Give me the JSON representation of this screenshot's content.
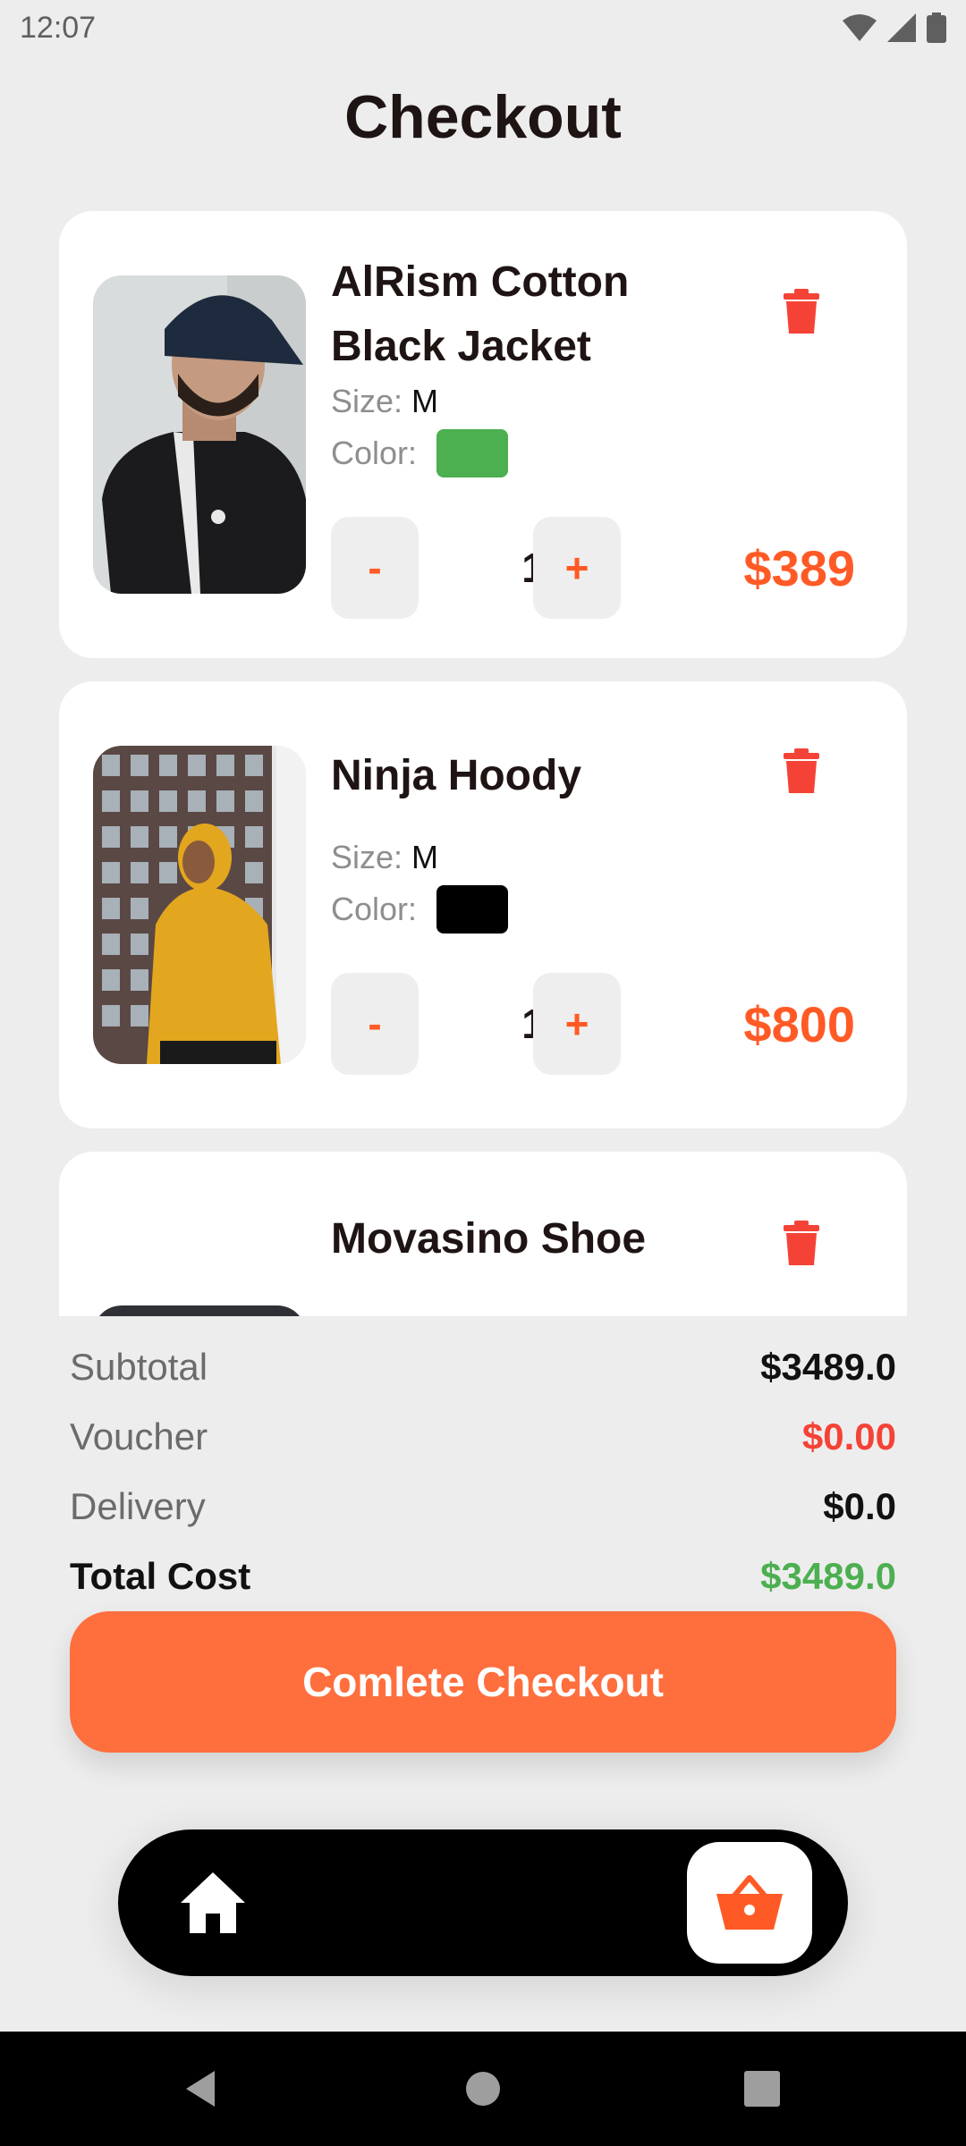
{
  "status_bar": {
    "time": "12:07"
  },
  "page": {
    "title": "Checkout"
  },
  "cart": {
    "items": [
      {
        "name": "AlRism Cotton Black Jacket",
        "size_label": "Size:",
        "size": "M",
        "color_label": "Color:",
        "color_hex": "#4caf50",
        "quantity": "1",
        "decrement_label": "-",
        "increment_label": "+",
        "price": "$389",
        "image_icon": "man-in-black-jacket-photo"
      },
      {
        "name": "Ninja Hoody",
        "size_label": "Size:",
        "size": "M",
        "color_label": "Color:",
        "color_hex": "#000000",
        "quantity": "1",
        "decrement_label": "-",
        "increment_label": "+",
        "price": "$800",
        "image_icon": "man-in-yellow-hoodie-photo"
      },
      {
        "name": "Movasino Shoe",
        "image_icon": "shoe-photo"
      }
    ]
  },
  "summary": {
    "subtotal_label": "Subtotal",
    "subtotal_value": "$3489.0",
    "voucher_label": "Voucher",
    "voucher_value": "$0.00",
    "delivery_label": "Delivery",
    "delivery_value": "$0.0",
    "total_label": "Total Cost",
    "total_value": "$3489.0"
  },
  "checkout_button": {
    "label": "Comlete Checkout"
  },
  "colors": {
    "accent": "#ff6e3d",
    "price": "#ff5a26",
    "delete": "#f44336",
    "voucher": "#f44336",
    "total": "#4caf50"
  },
  "bottom_nav": {
    "home_icon": "home-icon",
    "cart_icon": "shopping-basket-icon"
  }
}
